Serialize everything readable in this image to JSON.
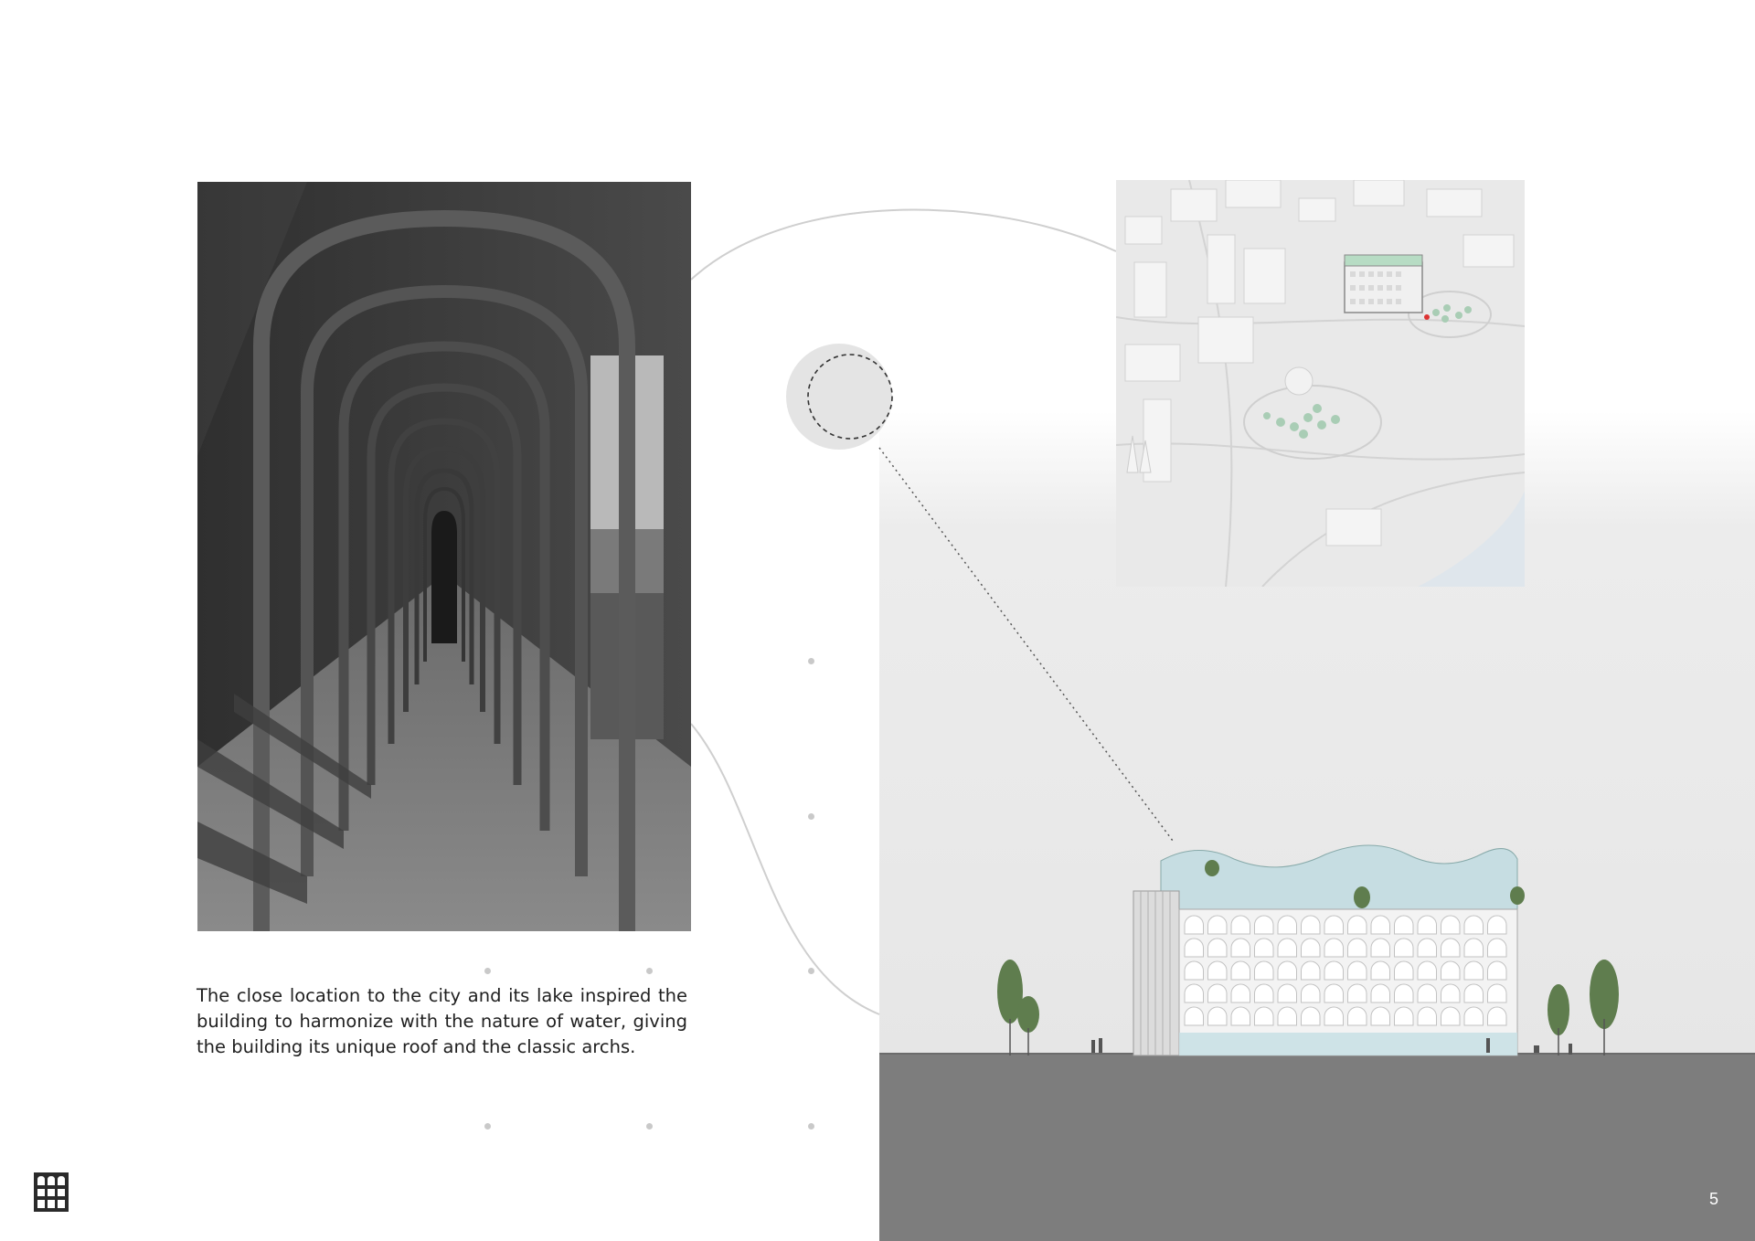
{
  "caption": {
    "text": "The close location to the city and its lake inspired the building to harmonize with the nature of water, giving the building its unique roof and the classic archs."
  },
  "page_number": "5",
  "images": {
    "arcade_photo": "arcade-photo",
    "site_map": "site-map",
    "elevation": "building-elevation"
  },
  "icons": {
    "logo": "arches-logo-icon",
    "marker": "site-marker-icon"
  },
  "colors": {
    "ground": "#7d7d7d",
    "panel": "#e9e9e9",
    "glass": "#bcd6dc",
    "tree": "#5f7d4e",
    "text": "#1f1f1f"
  }
}
